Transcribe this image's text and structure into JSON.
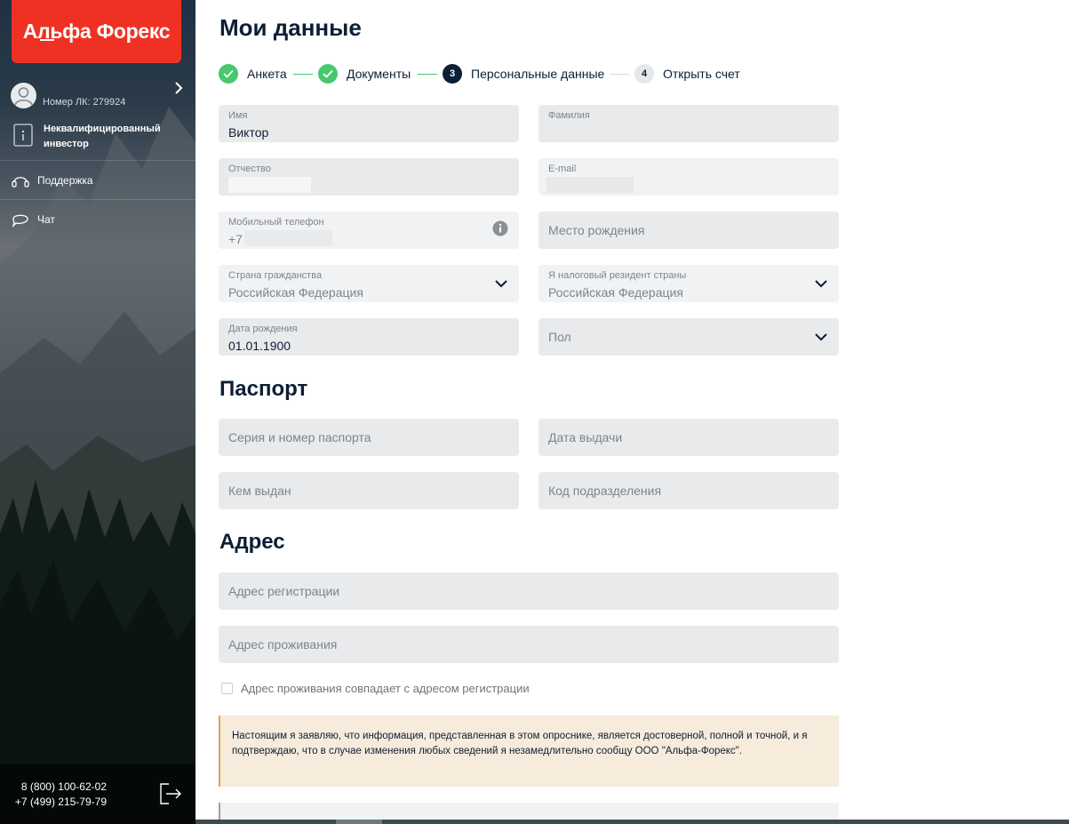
{
  "sidebar": {
    "logo": "Альфа Форекс",
    "lk_number": "Номер ЛК: 279924",
    "investor_status": "Неквалифицированный инвестор",
    "menu": [
      {
        "label": "Поддержка",
        "icon": "headset-icon"
      },
      {
        "label": "Чат",
        "icon": "chat-icon"
      }
    ],
    "phones": [
      "8 (800) 100-62-02",
      "+7 (499) 215-79-79"
    ]
  },
  "page": {
    "title": "Мои данные"
  },
  "stepper": {
    "steps": [
      {
        "label": "Анкета",
        "state": "done",
        "number": ""
      },
      {
        "label": "Документы",
        "state": "done",
        "number": ""
      },
      {
        "label": "Персональные данные",
        "state": "active",
        "number": "3"
      },
      {
        "label": "Открыть счет",
        "state": "todo",
        "number": "4"
      }
    ]
  },
  "personal": {
    "first_name": {
      "label": "Имя",
      "value": "Виктор"
    },
    "last_name": {
      "label": "Фамилия",
      "value": ""
    },
    "patronymic": {
      "label": "Отчество",
      "value": ""
    },
    "email": {
      "label": "E-mail",
      "value": ""
    },
    "phone": {
      "label": "Мобильный телефон",
      "value": "+7"
    },
    "birth_place": {
      "placeholder": "Место рождения"
    },
    "citizenship": {
      "label": "Страна гражданства",
      "value": "Российская Федерация"
    },
    "tax_residency": {
      "label": "Я налоговый резидент страны",
      "value": "Российская Федерация"
    },
    "birth_date": {
      "label": "Дата рождения",
      "value": "01.01.1900"
    },
    "gender": {
      "placeholder": "Пол"
    }
  },
  "passport": {
    "title": "Паспорт",
    "series_number": {
      "placeholder": "Серия и номер паспорта"
    },
    "issue_date": {
      "placeholder": "Дата выдачи"
    },
    "issued_by": {
      "placeholder": "Кем выдан"
    },
    "department_code": {
      "placeholder": "Код подразделения"
    }
  },
  "address": {
    "title": "Адрес",
    "registration": {
      "placeholder": "Адрес регистрации"
    },
    "residence": {
      "placeholder": "Адрес проживания"
    },
    "same_checkbox_label": "Адрес проживания совпадает с адресом регистрации"
  },
  "notice": {
    "text": "Настоящим я заявляю, что информация, представленная в этом опроснике, является достоверной, полной и точной, и я подтверждаю, что в случае изменения любых сведений я незамедлительно сообщу ООО \"Альфа-Форекс\"."
  },
  "colors": {
    "brand_red": "#ef3124",
    "step_done": "#47c76e",
    "step_active": "#0b1f35",
    "field_bg": "#e9eaec",
    "notice_bg": "#f7ebdb",
    "notice_border": "#e3a257"
  }
}
